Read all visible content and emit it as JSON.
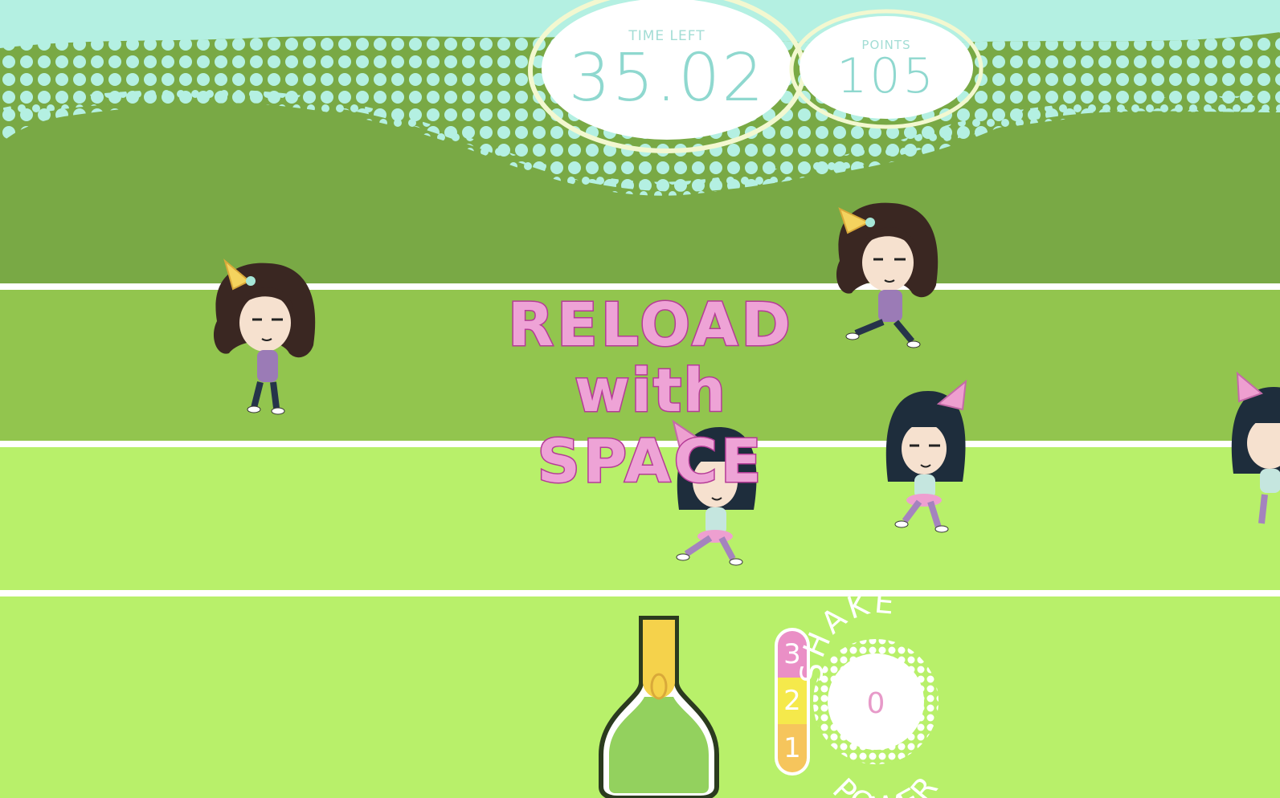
{
  "hud": {
    "time_label": "TIME LEFT",
    "time_value": "35.02",
    "points_label": "POINTS",
    "points_value": "105"
  },
  "overlay": {
    "lines": [
      "RELOAD",
      "with",
      "SPACE"
    ]
  },
  "shake_meter": {
    "levels": [
      "3",
      "2",
      "1"
    ],
    "title_top": "SHAKE",
    "title_bottom": "POWER",
    "value": "0"
  },
  "colors": {
    "sky": "#b4f0e2",
    "dark_grass": "#79a945",
    "mid_grass": "#92c54e",
    "light_grass": "#b8f06a",
    "lane_line": "#ffffff",
    "hud_text": "#8fd8cf",
    "overlay_fill": "#eea3d6",
    "overlay_stroke": "#b53b97",
    "bottle_glass": "#93d15e",
    "bottle_foil": "#f5d24b",
    "meter_pink": "#ea8fc6",
    "meter_yellow": "#f5e94b",
    "meter_orange": "#f6c55c"
  },
  "characters": [
    {
      "type": "brown-hair-girl",
      "hat": "yellow-party-hat"
    },
    {
      "type": "brown-hair-girl",
      "hat": "yellow-party-hat"
    },
    {
      "type": "black-hair-girl",
      "hat": "pink-party-hat"
    },
    {
      "type": "black-hair-girl",
      "hat": "pink-party-hat"
    },
    {
      "type": "black-hair-girl",
      "hat": "pink-party-hat"
    }
  ],
  "icons": [
    "champagne-bottle-icon",
    "party-hat-icon"
  ]
}
